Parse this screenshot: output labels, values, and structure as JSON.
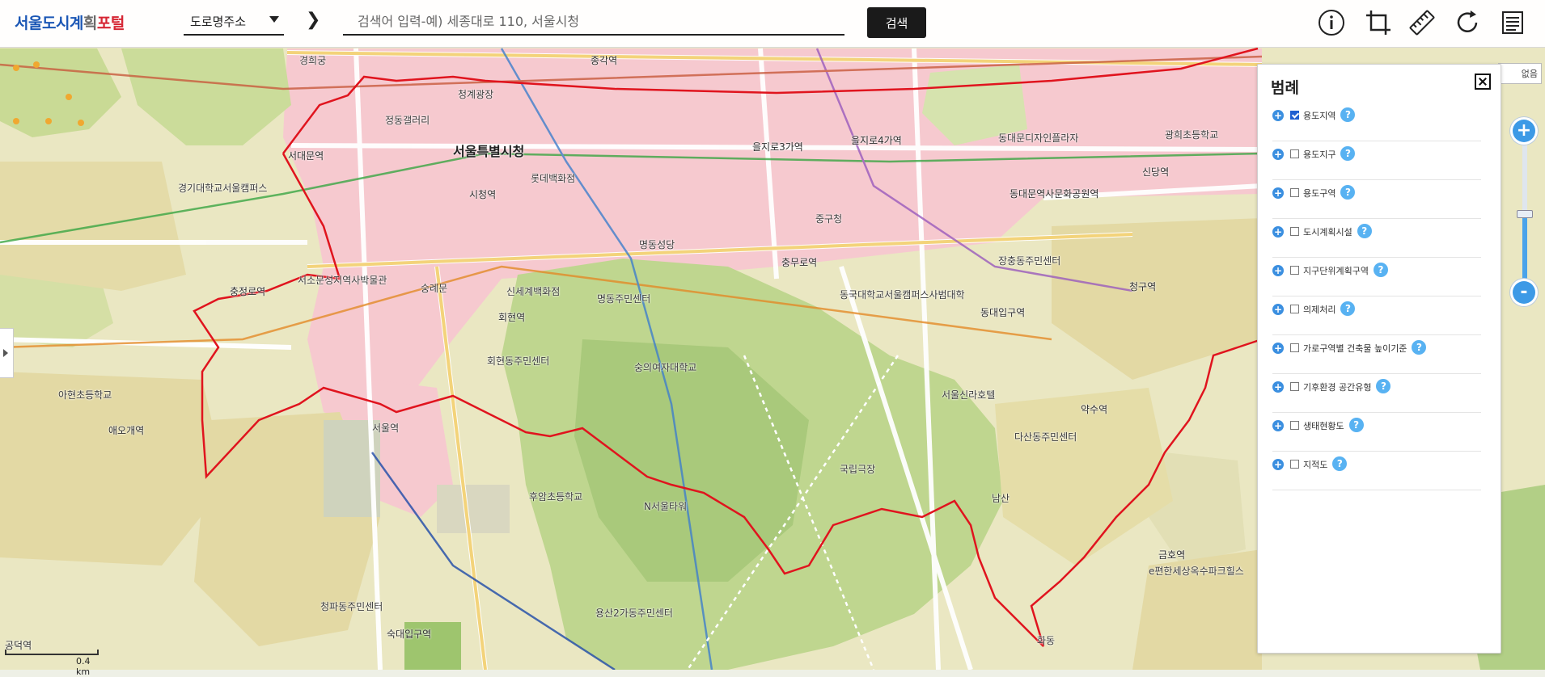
{
  "header": {
    "logo_part1": "서울도시계",
    "logo_part2": "획",
    "logo_part3": "포털",
    "address_type": "도로명주소",
    "search_placeholder": "검색어 입력-예) 세종대로 110, 서울시청",
    "search_button": "검색",
    "tools": [
      "info-icon",
      "crop-area-icon",
      "ruler-icon",
      "refresh-icon",
      "list-icon"
    ]
  },
  "legend": {
    "title": "범례",
    "items": [
      {
        "label": "용도지역",
        "checked": true
      },
      {
        "label": "용도지구",
        "checked": false
      },
      {
        "label": "용도구역",
        "checked": false
      },
      {
        "label": "도시계획시설",
        "checked": false
      },
      {
        "label": "지구단위계획구역",
        "checked": false
      },
      {
        "label": "의제처리",
        "checked": false
      },
      {
        "label": "가로구역별 건축물 높이기준",
        "checked": false
      },
      {
        "label": "기후환경 공간유형",
        "checked": false
      },
      {
        "label": "생태현황도",
        "checked": false
      },
      {
        "label": "지적도",
        "checked": false
      }
    ],
    "help_glyph": "?"
  },
  "zoom": {
    "in": "+",
    "out": "-"
  },
  "no_layer_label": "없음",
  "scale": {
    "label": "0.4 km"
  },
  "map_labels": {
    "city_hall": "서울특별시청",
    "seoul_station": "서울역",
    "n_tower": "N서울타워",
    "namsan": "남산",
    "sungnyemun": "숭례문",
    "myeongdong": "명동주민센터",
    "jongno": "종각역",
    "euljiro3": "을지로3가역",
    "euljiro4": "을지로4가역",
    "dongdaemun_hist": "동대문역사문화공원역",
    "sindang": "신당역",
    "cheonggu": "청구역",
    "yaksu": "약수역",
    "chungmuro": "충무로역",
    "dongguk": "동대입구역",
    "hoehyeon": "회현역",
    "sicheong": "시청역",
    "seodaemun": "서대문역",
    "chungjeongno": "충정로역",
    "sookmyung": "숙대입구역",
    "aeogae": "애오개역",
    "gongdeok": "공덕역",
    "geumho": "금호역",
    "seoul_shilla": "서울신라호텔",
    "gwanghui": "광희초등학교",
    "jangchung": "장충동주민센터",
    "seosomun": "서소문성지역사박물관",
    "lotte_dept": "롯데백화점",
    "shinsegae": "신세계백화점",
    "sungui_univ": "숭의여자대학교",
    "dongguk_univ": "동국대학교서울캠퍼스사범대학",
    "dongdaemun_dp": "동대문디자인플라자",
    "hoehyeon_center": "회현동주민센터",
    "huam_school": "후암초등학교",
    "yongsan_center": "용산2가동주민센터",
    "gyeonghui": "경희궁",
    "kyonggi_univ": "경기대학교서울캠퍼스",
    "sajik": "정동갤러리",
    "ahyeon": "아현초등학교",
    "cheongpa": "청파동주민센터",
    "sinsegye": "e편한세상옥수파크힐스",
    "daishin": "다산동주민센터",
    "gukrip_theater": "국립극장",
    "myeongdong_cathedral": "명동성당",
    "hwaemeong": "화동",
    "sinjung": "중구청",
    "cheonggye": "청계광장"
  }
}
